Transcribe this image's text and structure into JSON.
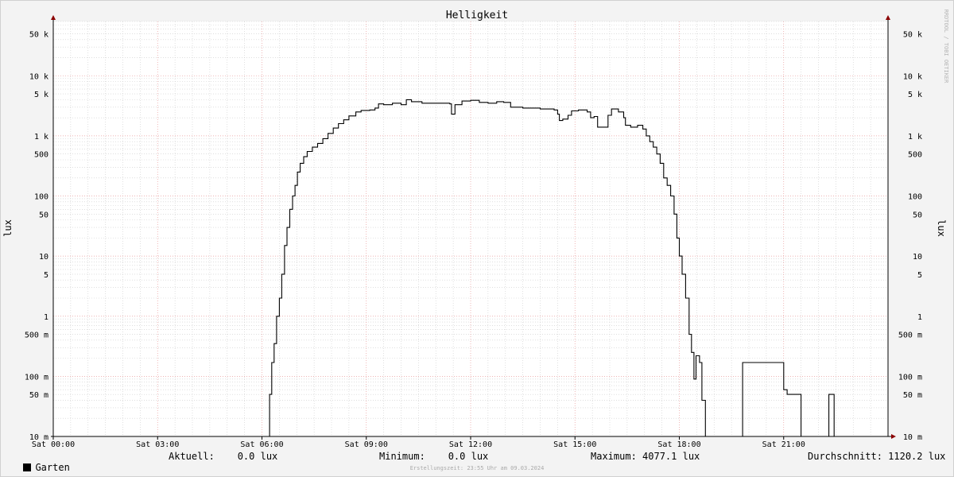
{
  "chart_data": {
    "type": "line",
    "title": "Helligkeit",
    "ylabel_left": "lux",
    "ylabel_right": "lux",
    "yscale": "log",
    "ylim": [
      0.01,
      80000
    ],
    "xlim": [
      0,
      24
    ],
    "x_unit": "hours (Sat 00:00 – Sun 00:00)",
    "x_ticks": [
      {
        "x": 0,
        "label": "Sat 00:00"
      },
      {
        "x": 3,
        "label": "Sat 03:00"
      },
      {
        "x": 6,
        "label": "Sat 06:00"
      },
      {
        "x": 9,
        "label": "Sat 09:00"
      },
      {
        "x": 12,
        "label": "Sat 12:00"
      },
      {
        "x": 15,
        "label": "Sat 15:00"
      },
      {
        "x": 18,
        "label": "Sat 18:00"
      },
      {
        "x": 21,
        "label": "Sat 21:00"
      }
    ],
    "y_ticks": [
      {
        "v": 50000,
        "label": "50 k"
      },
      {
        "v": 10000,
        "label": "10 k"
      },
      {
        "v": 5000,
        "label": "5 k"
      },
      {
        "v": 1000,
        "label": "1 k"
      },
      {
        "v": 500,
        "label": "500"
      },
      {
        "v": 100,
        "label": "100"
      },
      {
        "v": 50,
        "label": "50"
      },
      {
        "v": 10,
        "label": "10"
      },
      {
        "v": 5,
        "label": "5"
      },
      {
        "v": 1,
        "label": "1"
      },
      {
        "v": 0.5,
        "label": "500 m"
      },
      {
        "v": 0.1,
        "label": "100 m"
      },
      {
        "v": 0.05,
        "label": "50 m"
      },
      {
        "v": 0.01,
        "label": "10 m"
      }
    ],
    "series": [
      {
        "name": "Garten",
        "color": "#000000",
        "points": [
          [
            0,
            0.01
          ],
          [
            6.2,
            0.01
          ],
          [
            6.22,
            0.05
          ],
          [
            6.28,
            0.17
          ],
          [
            6.35,
            0.35
          ],
          [
            6.42,
            1.0
          ],
          [
            6.5,
            2.0
          ],
          [
            6.57,
            5.0
          ],
          [
            6.65,
            15
          ],
          [
            6.72,
            30
          ],
          [
            6.8,
            60
          ],
          [
            6.88,
            100
          ],
          [
            6.95,
            150
          ],
          [
            7.02,
            250
          ],
          [
            7.1,
            350
          ],
          [
            7.2,
            450
          ],
          [
            7.3,
            550
          ],
          [
            7.45,
            650
          ],
          [
            7.6,
            750
          ],
          [
            7.75,
            900
          ],
          [
            7.9,
            1100
          ],
          [
            8.05,
            1350
          ],
          [
            8.2,
            1600
          ],
          [
            8.35,
            1850
          ],
          [
            8.5,
            2150
          ],
          [
            8.7,
            2500
          ],
          [
            8.85,
            2650
          ],
          [
            9.1,
            2700
          ],
          [
            9.25,
            2900
          ],
          [
            9.35,
            3400
          ],
          [
            9.5,
            3300
          ],
          [
            9.75,
            3500
          ],
          [
            10.0,
            3300
          ],
          [
            10.15,
            4000
          ],
          [
            10.3,
            3700
          ],
          [
            10.6,
            3500
          ],
          [
            11.0,
            3500
          ],
          [
            11.4,
            3400
          ],
          [
            11.45,
            2300
          ],
          [
            11.55,
            3300
          ],
          [
            11.75,
            3800
          ],
          [
            12.0,
            3900
          ],
          [
            12.25,
            3600
          ],
          [
            12.5,
            3500
          ],
          [
            12.75,
            3700
          ],
          [
            12.95,
            3600
          ],
          [
            13.15,
            3000
          ],
          [
            13.5,
            2900
          ],
          [
            14.0,
            2800
          ],
          [
            14.4,
            2700
          ],
          [
            14.5,
            2300
          ],
          [
            14.55,
            1800
          ],
          [
            14.65,
            1900
          ],
          [
            14.8,
            2200
          ],
          [
            14.9,
            2600
          ],
          [
            15.1,
            2700
          ],
          [
            15.35,
            2500
          ],
          [
            15.45,
            2000
          ],
          [
            15.55,
            2100
          ],
          [
            15.65,
            1400
          ],
          [
            15.9,
            1400
          ],
          [
            15.95,
            2200
          ],
          [
            16.05,
            2800
          ],
          [
            16.25,
            2500
          ],
          [
            16.4,
            2000
          ],
          [
            16.45,
            1500
          ],
          [
            16.6,
            1400
          ],
          [
            16.8,
            1500
          ],
          [
            16.95,
            1300
          ],
          [
            17.05,
            1000
          ],
          [
            17.15,
            800
          ],
          [
            17.25,
            650
          ],
          [
            17.35,
            500
          ],
          [
            17.45,
            350
          ],
          [
            17.55,
            200
          ],
          [
            17.65,
            150
          ],
          [
            17.75,
            100
          ],
          [
            17.85,
            50
          ],
          [
            17.93,
            20
          ],
          [
            18.0,
            10
          ],
          [
            18.08,
            5
          ],
          [
            18.18,
            2
          ],
          [
            18.28,
            0.5
          ],
          [
            18.35,
            0.25
          ],
          [
            18.42,
            0.09
          ],
          [
            18.48,
            0.22
          ],
          [
            18.58,
            0.17
          ],
          [
            18.65,
            0.04
          ],
          [
            18.75,
            0.01
          ],
          [
            19.75,
            0.01
          ],
          [
            19.82,
            0.17
          ],
          [
            20.0,
            0.17
          ],
          [
            20.5,
            0.17
          ],
          [
            20.95,
            0.17
          ],
          [
            21.0,
            0.06
          ],
          [
            21.1,
            0.05
          ],
          [
            21.4,
            0.05
          ],
          [
            21.5,
            0.01
          ],
          [
            22.25,
            0.01
          ],
          [
            22.3,
            0.05
          ],
          [
            22.4,
            0.05
          ],
          [
            22.45,
            0.01
          ],
          [
            23.1,
            0.01
          ]
        ]
      }
    ],
    "grid": true
  },
  "legend": {
    "series_name": "Garten",
    "current": "Aktuell:    0.0 lux",
    "minimum": "Minimum:    0.0 lux",
    "maximum": "Maximum: 4077.1 lux",
    "average": "Durchschnitt: 1120.2 lux"
  },
  "watermark": "RRDTOOL / TOBI OETIKER",
  "footer": "Erstellungszeit: 23:55 Uhr am 09.03.2024",
  "colors": {
    "background": "#f3f3f3",
    "plot": "#ffffff",
    "major_grid": "#e89a9a",
    "minor_grid": "#cccccc",
    "line": "#000000",
    "axis_arrow": "#8b0000"
  }
}
